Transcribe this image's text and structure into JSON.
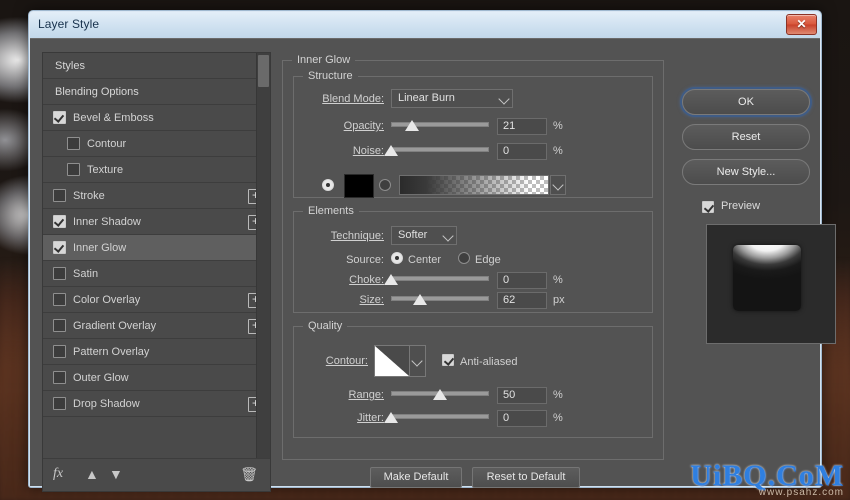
{
  "window": {
    "title": "Layer Style",
    "close_label": "✕"
  },
  "styles_panel": {
    "items": [
      {
        "label": "Styles",
        "checkbox": null,
        "sub": false,
        "plus": false,
        "selected": false
      },
      {
        "label": "Blending Options",
        "checkbox": null,
        "sub": false,
        "plus": false,
        "selected": false
      },
      {
        "label": "Bevel & Emboss",
        "checkbox": true,
        "sub": false,
        "plus": false,
        "selected": false
      },
      {
        "label": "Contour",
        "checkbox": false,
        "sub": true,
        "plus": false,
        "selected": false
      },
      {
        "label": "Texture",
        "checkbox": false,
        "sub": true,
        "plus": false,
        "selected": false
      },
      {
        "label": "Stroke",
        "checkbox": false,
        "sub": false,
        "plus": true,
        "selected": false
      },
      {
        "label": "Inner Shadow",
        "checkbox": true,
        "sub": false,
        "plus": true,
        "selected": false
      },
      {
        "label": "Inner Glow",
        "checkbox": true,
        "sub": false,
        "plus": false,
        "selected": true
      },
      {
        "label": "Satin",
        "checkbox": false,
        "sub": false,
        "plus": false,
        "selected": false
      },
      {
        "label": "Color Overlay",
        "checkbox": false,
        "sub": false,
        "plus": true,
        "selected": false
      },
      {
        "label": "Gradient Overlay",
        "checkbox": false,
        "sub": false,
        "plus": true,
        "selected": false
      },
      {
        "label": "Pattern Overlay",
        "checkbox": false,
        "sub": false,
        "plus": false,
        "selected": false
      },
      {
        "label": "Outer Glow",
        "checkbox": false,
        "sub": false,
        "plus": false,
        "selected": false
      },
      {
        "label": "Drop Shadow",
        "checkbox": false,
        "sub": false,
        "plus": true,
        "selected": false
      }
    ],
    "footer": {
      "fx": "fx",
      "move_up": "▲",
      "move_down": "▼",
      "delete": "🗑"
    }
  },
  "main": {
    "section_title": "Inner Glow",
    "structure": {
      "legend": "Structure",
      "blend_mode_label": "Blend Mode:",
      "blend_mode_value": "Linear Burn",
      "opacity_label": "Opacity:",
      "opacity_value": "21",
      "opacity_unit": "%",
      "opacity_percent": 21,
      "noise_label": "Noise:",
      "noise_value": "0",
      "noise_unit": "%",
      "noise_percent": 0,
      "fill_type": "color",
      "color_value": "#000000"
    },
    "elements": {
      "legend": "Elements",
      "technique_label": "Technique:",
      "technique_value": "Softer",
      "source_label": "Source:",
      "source_center_label": "Center",
      "source_edge_label": "Edge",
      "source_value": "Center",
      "choke_label": "Choke:",
      "choke_value": "0",
      "choke_unit": "%",
      "choke_percent": 0,
      "size_label": "Size:",
      "size_value": "62",
      "size_unit": "px",
      "size_percent": 30
    },
    "quality": {
      "legend": "Quality",
      "contour_label": "Contour:",
      "anti_aliased_label": "Anti-aliased",
      "anti_aliased_checked": true,
      "range_label": "Range:",
      "range_value": "50",
      "range_unit": "%",
      "range_percent": 50,
      "jitter_label": "Jitter:",
      "jitter_value": "0",
      "jitter_unit": "%",
      "jitter_percent": 0
    },
    "make_default_label": "Make Default",
    "reset_to_default_label": "Reset to Default"
  },
  "right": {
    "ok_label": "OK",
    "reset_label": "Reset",
    "new_style_label": "New Style...",
    "preview_label": "Preview",
    "preview_checked": true
  },
  "watermark": {
    "main": "UiBQ.CoM",
    "sub": "www.psahz.com"
  },
  "colors": {
    "dialog_bg": "#535353",
    "panel_bg": "#4a4a4a",
    "accent_focus": "#3f5c86",
    "title_text": "#18324d",
    "close_red": "#d9583d"
  }
}
